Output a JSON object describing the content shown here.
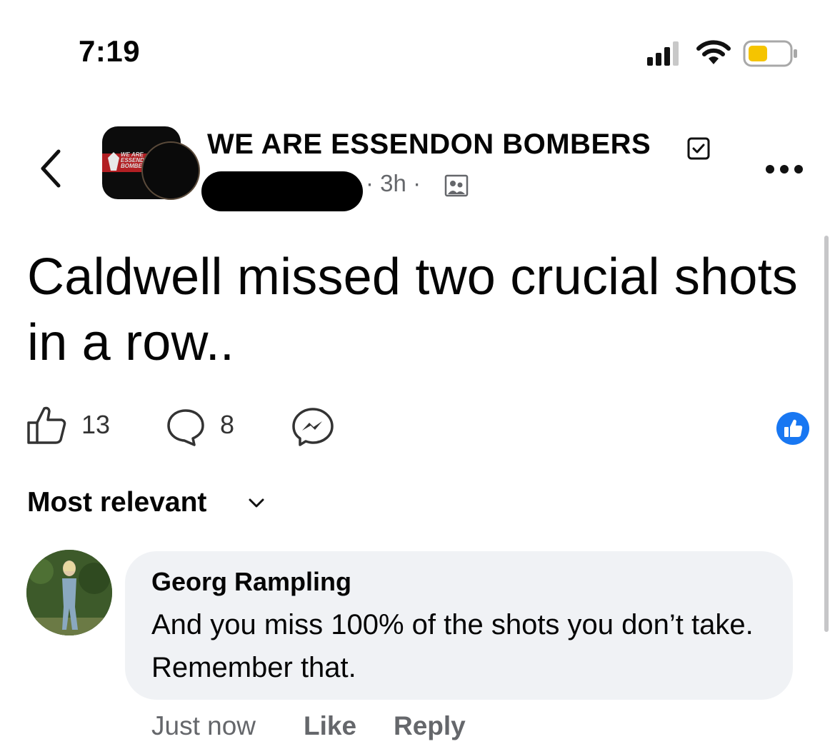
{
  "status_bar": {
    "time": "7:19"
  },
  "post": {
    "page_name": "WE ARE ESSENDON BOMBERS",
    "logo_text": "WE ARE ESSENDON BOMBERS",
    "meta_prefix": "·",
    "time_ago": "3h",
    "separator": "·",
    "text": "Caldwell missed two crucial shots in a row..",
    "like_count": "13",
    "comment_count": "8",
    "accent_color": "#1877f2"
  },
  "comments": {
    "sort_label": "Most relevant",
    "items": [
      {
        "author": "Georg Rampling",
        "text": "And you miss 100% of the shots you don’t take. Remember that.",
        "time": "Just now",
        "like_label": "Like",
        "reply_label": "Reply"
      }
    ]
  },
  "icons": [
    "back-chevron-icon",
    "verified-icon",
    "more-icon",
    "like-icon",
    "comment-icon",
    "messenger-icon",
    "like-reaction-icon",
    "chevron-down-icon",
    "album-icon",
    "signal-icon",
    "wifi-icon",
    "battery-icon"
  ]
}
